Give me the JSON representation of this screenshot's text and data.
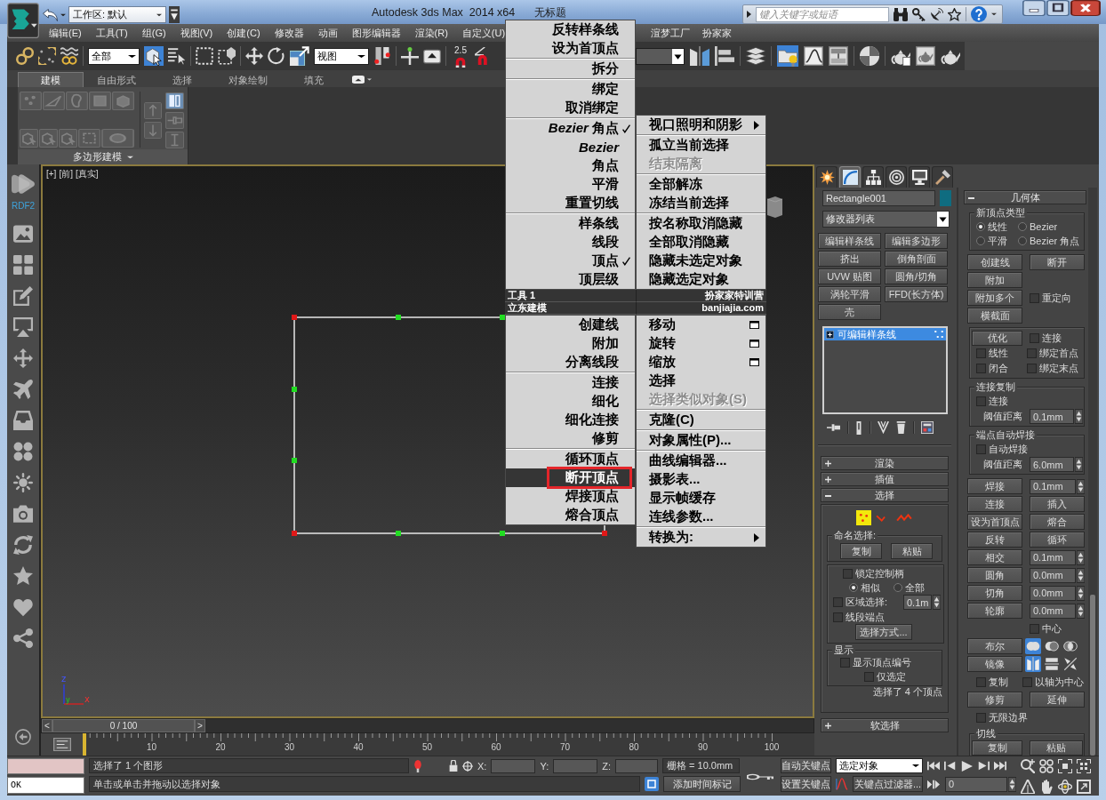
{
  "title_bar": {
    "workspace": "工作区: 默认",
    "title": "Autodesk 3ds Max  2014 x64",
    "document": "无标题",
    "search_placeholder": "键入关键字或短语"
  },
  "menu_bar": {
    "items": [
      "编辑(E)",
      "工具(T)",
      "组(G)",
      "视图(V)",
      "创建(C)",
      "修改器",
      "动画",
      "图形编辑器",
      "渲染(R)",
      "自定义(U)"
    ],
    "items_right": [
      "渲梦工厂",
      "扮家家"
    ]
  },
  "main_toolbar": {
    "selection_filter": "全部",
    "select_object_active": true,
    "reference_coordinate": "视图",
    "snap_label": "2.5",
    "scene_explorer_active": true
  },
  "ribbon": {
    "tabs": [
      {
        "label": "建模",
        "selected": true
      },
      {
        "label": "自由形式",
        "selected": false
      },
      {
        "label": "选择",
        "selected": false
      },
      {
        "label": "对象绘制",
        "selected": false
      },
      {
        "label": "填充",
        "selected": false
      }
    ],
    "panel_title": "多边形建模"
  },
  "plugin_sidebar": {
    "title": "RDF2"
  },
  "viewport": {
    "labels": [
      "[+]",
      "[前]",
      "[真实]"
    ],
    "axes": [
      "z",
      "y",
      "x"
    ]
  },
  "quad_menu": {
    "top_left": [
      [
        {
          "label": "反转样条线",
          "checked": false
        },
        {
          "label": "设为首顶点",
          "checked": false
        }
      ],
      [
        {
          "label": "拆分",
          "checked": false
        }
      ],
      [
        {
          "label": "绑定",
          "checked": false
        },
        {
          "label": "取消绑定",
          "checked": false
        }
      ],
      [
        {
          "label": "*Bezier* 角点",
          "checked": true
        },
        {
          "label": "Bezier",
          "italic": true,
          "checked": false
        },
        {
          "label": "角点",
          "checked": false
        },
        {
          "label": "平滑",
          "checked": false
        },
        {
          "label": "重置切线",
          "checked": false
        }
      ],
      [
        {
          "label": "样条线",
          "checked": false
        },
        {
          "label": "线段",
          "checked": false
        },
        {
          "label": "顶点",
          "checked": true
        },
        {
          "label": "顶层级",
          "checked": false
        }
      ]
    ],
    "top_right": [
      [
        {
          "label": "视口照明和阴影",
          "disabled": false,
          "submenu": true
        }
      ],
      [
        {
          "label": "孤立当前选择",
          "disabled": false,
          "submenu": false
        },
        {
          "label": "结束隔离",
          "disabled": true,
          "submenu": false
        }
      ],
      [
        {
          "label": "全部解冻",
          "disabled": false,
          "submenu": false
        },
        {
          "label": "冻结当前选择",
          "disabled": false,
          "submenu": false
        }
      ],
      [
        {
          "label": "按名称取消隐藏",
          "disabled": false,
          "submenu": false
        },
        {
          "label": "全部取消隐藏",
          "disabled": false,
          "submenu": false
        },
        {
          "label": "隐藏未选定对象",
          "disabled": false,
          "submenu": false
        },
        {
          "label": "隐藏选定对象",
          "disabled": false,
          "submenu": false
        }
      ]
    ],
    "headers": [
      {
        "left": "工具 1",
        "right": "扮家家特训营"
      },
      {
        "left": "立东建模",
        "right": "banjiajia.com"
      }
    ],
    "bottom_left": [
      [
        {
          "label": "创建线",
          "selected": false
        },
        {
          "label": "附加",
          "selected": false
        },
        {
          "label": "分离线段",
          "selected": false
        }
      ],
      [
        {
          "label": "连接",
          "selected": false
        },
        {
          "label": "细化",
          "selected": false
        },
        {
          "label": "细化连接",
          "selected": false
        },
        {
          "label": "修剪",
          "selected": false
        }
      ],
      [
        {
          "label": "循环顶点",
          "selected": false
        },
        {
          "label": "断开顶点",
          "selected": true
        },
        {
          "label": "焊接顶点",
          "selected": false
        },
        {
          "label": "熔合顶点",
          "selected": false
        }
      ]
    ],
    "bottom_right": [
      [
        {
          "label": "移动",
          "options": true,
          "disabled": false,
          "submenu": false
        },
        {
          "label": "旋转",
          "options": true,
          "disabled": false,
          "submenu": false
        },
        {
          "label": "缩放",
          "options": true,
          "disabled": false,
          "submenu": false
        },
        {
          "label": "选择",
          "options": false,
          "disabled": false,
          "submenu": false
        },
        {
          "label": "选择类似对象(S)",
          "options": false,
          "disabled": true,
          "submenu": false
        }
      ],
      [
        {
          "label": "克隆(C)",
          "options": false,
          "disabled": false,
          "submenu": false
        }
      ],
      [
        {
          "label": "对象属性(P)...",
          "options": false,
          "disabled": false,
          "submenu": false
        }
      ],
      [
        {
          "label": "曲线编辑器...",
          "options": false,
          "disabled": false,
          "submenu": false
        },
        {
          "label": "摄影表...",
          "options": false,
          "disabled": false,
          "submenu": false
        },
        {
          "label": "显示帧缓存",
          "options": false,
          "disabled": false,
          "submenu": false
        },
        {
          "label": "连线参数...",
          "options": false,
          "disabled": false,
          "submenu": false
        }
      ],
      [
        {
          "label": "转换为:",
          "options": false,
          "disabled": false,
          "submenu": true
        }
      ]
    ]
  },
  "command_panel": {
    "tabs": [
      {
        "selected": false
      },
      {
        "selected": true
      },
      {
        "selected": false
      },
      {
        "selected": false
      },
      {
        "selected": false
      },
      {
        "selected": false
      }
    ],
    "object_name": "Rectangle001",
    "modifier_list": "修改器列表",
    "modifier_buttons": [
      "编辑样条线",
      "编辑多边形",
      "挤出",
      "倒角剖面",
      "UVW 贴图",
      "圆角/切角",
      "涡轮平滑",
      "FFD(长方体)",
      "壳"
    ],
    "modifier_stack": [
      {
        "label": "可编辑样条线",
        "selected": true
      }
    ],
    "rollouts": [
      {
        "title": "渲染",
        "expanded": false
      },
      {
        "title": "插值",
        "expanded": false
      },
      {
        "title": "选择",
        "expanded": true,
        "content": {
          "levels": [
            {
              "selected": true
            },
            {
              "selected": false
            },
            {
              "selected": false
            }
          ],
          "named_selection": {
            "title": "命名选择:",
            "buttons": [
              "复制",
              "粘贴"
            ]
          },
          "lock_handles": {
            "label": "锁定控制柄",
            "checked": false
          },
          "handle_mode": [
            {
              "label": "相似",
              "selected": true
            },
            {
              "label": "全部",
              "selected": false
            }
          ],
          "area_selection": {
            "label": "区域选择:",
            "checked": false,
            "value": "0.1m"
          },
          "segment_end": {
            "label": "线段端点",
            "checked": false
          },
          "select_by": "选择方式...",
          "display": {
            "title": "显示",
            "options": [
              {
                "label": "显示顶点编号",
                "checked": false
              },
              {
                "label": "仅选定",
                "checked": false
              }
            ]
          },
          "status": "选择了 4 个顶点"
        }
      },
      {
        "title": "软选择",
        "expanded": false
      }
    ],
    "geometry": {
      "title": "几何体",
      "expanded": true,
      "sections": [
        {
          "kind": "group",
          "title": "新顶点类型",
          "rows": [
            {
              "left": {
                "kind": "radio",
                "label": "线性",
                "selected": true
              },
              "right": {
                "kind": "radio",
                "label": "Bezier",
                "selected": false
              }
            },
            {
              "left": {
                "kind": "radio",
                "label": "平滑",
                "selected": false
              },
              "right": {
                "kind": "radio",
                "label": "Bezier 角点",
                "selected": false
              }
            }
          ]
        },
        {
          "kind": "plain",
          "rows": [
            {
              "left": {
                "kind": "button",
                "label": "创建线"
              },
              "right": {
                "kind": "button",
                "label": "断开"
              }
            },
            {
              "left": {
                "kind": "button",
                "label": "附加"
              }
            },
            {
              "left": {
                "kind": "button",
                "label": "附加多个"
              },
              "right": {
                "kind": "checkbox",
                "label": "重定向",
                "checked": false
              }
            },
            {
              "left": {
                "kind": "button",
                "label": "横截面"
              }
            }
          ]
        },
        {
          "kind": "group",
          "rows": [
            {
              "left": {
                "kind": "button",
                "label": "优化"
              },
              "right": {
                "kind": "checkbox",
                "label": "连接",
                "checked": false
              }
            },
            {
              "left": {
                "kind": "checkbox",
                "label": "线性",
                "checked": false
              },
              "right": {
                "kind": "checkbox",
                "label": "绑定首点",
                "checked": false
              }
            },
            {
              "left": {
                "kind": "checkbox",
                "label": "闭合",
                "checked": false
              },
              "right": {
                "kind": "checkbox",
                "label": "绑定末点",
                "checked": false
              }
            }
          ]
        },
        {
          "kind": "group",
          "title": "连接复制",
          "rows": [
            {
              "left": {
                "kind": "checkbox",
                "label": "连接",
                "checked": false
              }
            },
            {
              "left": {
                "kind": "label",
                "label": "阈值距离"
              },
              "right": {
                "kind": "spinner",
                "value": "0.1mm"
              }
            }
          ]
        },
        {
          "kind": "group",
          "title": "端点自动焊接",
          "rows": [
            {
              "left": {
                "kind": "checkbox",
                "label": "自动焊接",
                "checked": false
              }
            },
            {
              "left": {
                "kind": "label",
                "label": "阈值距离"
              },
              "right": {
                "kind": "spinner",
                "value": "6.0mm"
              }
            }
          ]
        },
        {
          "kind": "plain",
          "rows": [
            {
              "left": {
                "kind": "button",
                "label": "焊接"
              },
              "right": {
                "kind": "spinner",
                "value": "0.1mm"
              }
            },
            {
              "left": {
                "kind": "button",
                "label": "连接"
              },
              "right": {
                "kind": "button",
                "label": "插入"
              }
            },
            {
              "left": {
                "kind": "button",
                "label": "设为首顶点"
              },
              "right": {
                "kind": "button",
                "label": "熔合"
              }
            },
            {
              "left": {
                "kind": "button",
                "label": "反转"
              },
              "right": {
                "kind": "button",
                "label": "循环"
              }
            },
            {
              "left": {
                "kind": "button",
                "label": "相交"
              },
              "right": {
                "kind": "spinner",
                "value": "0.1mm"
              }
            },
            {
              "left": {
                "kind": "button",
                "label": "圆角"
              },
              "right": {
                "kind": "spinner",
                "value": "0.0mm"
              }
            },
            {
              "left": {
                "kind": "button",
                "label": "切角"
              },
              "right": {
                "kind": "spinner",
                "value": "0.0mm"
              }
            },
            {
              "left": {
                "kind": "button",
                "label": "轮廓"
              },
              "right": {
                "kind": "spinner",
                "value": "0.0mm"
              }
            },
            {
              "right": {
                "kind": "checkbox",
                "label": "中心",
                "checked": false
              }
            },
            {
              "left": {
                "kind": "button",
                "label": "布尔"
              },
              "right": {
                "kind": "boolean_toggles",
                "items": [
                  {
                    "selected": true
                  },
                  {
                    "selected": false
                  },
                  {
                    "selected": false
                  }
                ]
              }
            },
            {
              "left": {
                "kind": "button",
                "label": "镜像"
              },
              "right": {
                "kind": "mirror_toggles",
                "items": [
                  {
                    "selected": true
                  },
                  {
                    "selected": false
                  },
                  {
                    "selected": false
                  }
                ]
              }
            },
            {
              "left": {
                "kind": "checkbox",
                "label": "复制",
                "checked": false
              },
              "right": {
                "kind": "checkbox",
                "label": "以轴为中心",
                "checked": false
              }
            },
            {
              "left": {
                "kind": "button",
                "label": "修剪"
              },
              "right": {
                "kind": "button",
                "label": "延伸"
              }
            },
            {
              "left": {
                "kind": "checkbox",
                "label": "无限边界",
                "checked": false
              }
            }
          ]
        },
        {
          "kind": "group",
          "title": "切线",
          "rows": [
            {
              "left": {
                "kind": "button",
                "label": "复制"
              },
              "right": {
                "kind": "button",
                "label": "粘贴"
              }
            }
          ]
        }
      ]
    }
  },
  "timeline": {
    "previous": "<",
    "position": "0 / 100",
    "next": ">",
    "level": 0,
    "ruler_labels": [
      "10",
      "20",
      "30",
      "40",
      "50",
      "60",
      "70",
      "80",
      "90",
      "100"
    ]
  },
  "status_bar": {
    "listener_output": "OK",
    "selection_status": "选择了 1 个图形",
    "coordinates": [
      "X:",
      "Y:",
      "Z:"
    ],
    "grid": "栅格 = 10.0mm",
    "prompt": "单击或单击并拖动以选择对象",
    "add_time_tag": "添加时间标记",
    "auto_key": "自动关键点",
    "set_key": "设置关键点",
    "key_target": "选定对象",
    "key_filters": "关键点过滤器...",
    "current_frame": "0"
  }
}
